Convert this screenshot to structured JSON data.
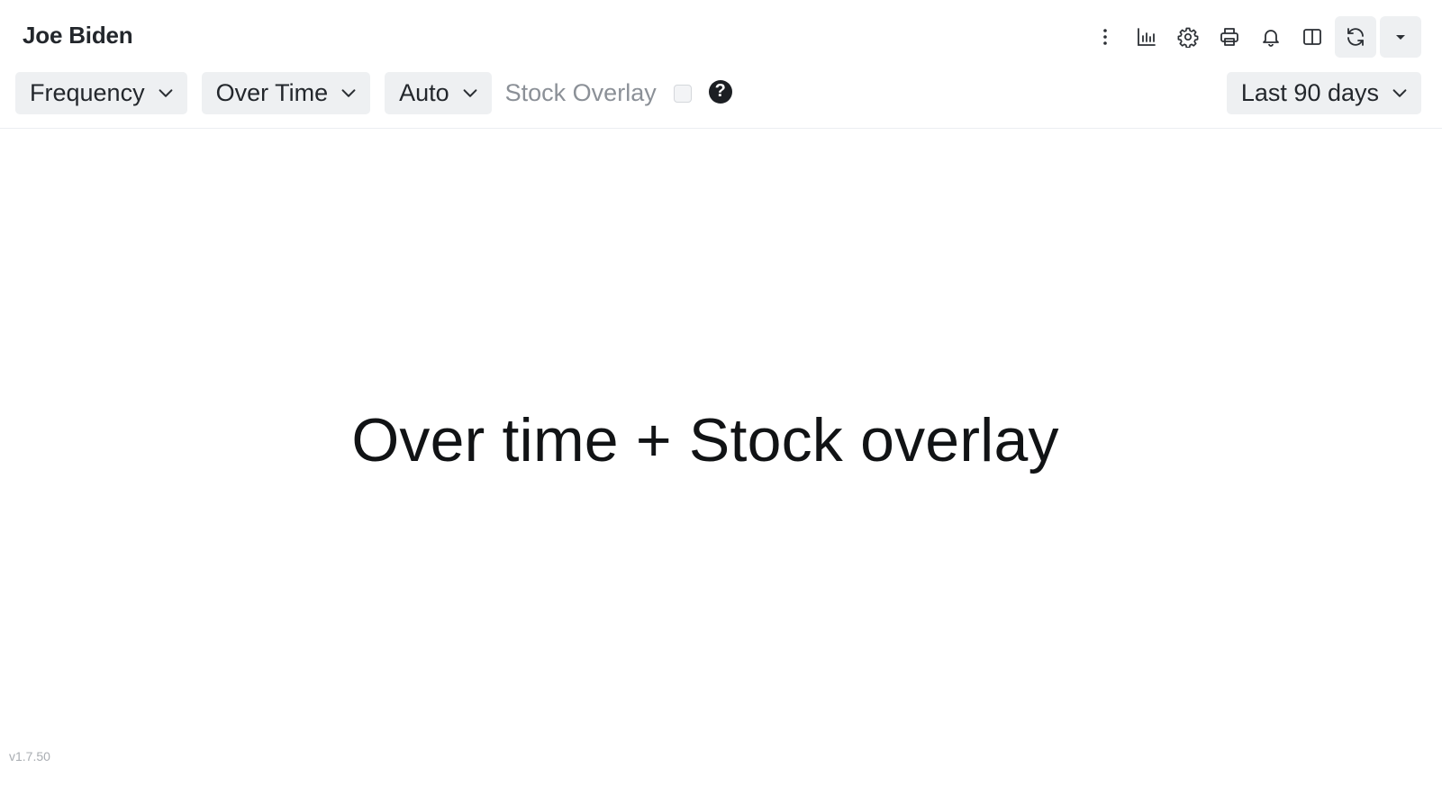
{
  "header": {
    "title": "Joe Biden",
    "icons": [
      "more-vertical-icon",
      "bar-chart-icon",
      "gear-icon",
      "printer-icon",
      "bell-icon",
      "split-view-icon",
      "refresh-icon",
      "caret-down-icon"
    ]
  },
  "toolbar": {
    "metric": "Frequency",
    "view": "Over Time",
    "interval": "Auto",
    "stock_overlay_label": "Stock Overlay",
    "stock_overlay_checked": false,
    "help_glyph": "?",
    "date_range": "Last 90 days"
  },
  "main": {
    "message": "Over time + Stock overlay"
  },
  "footer": {
    "version": "v1.7.50"
  },
  "colors": {
    "button_bg": "#eef0f2",
    "text": "#23272c",
    "muted": "#8b9097"
  }
}
